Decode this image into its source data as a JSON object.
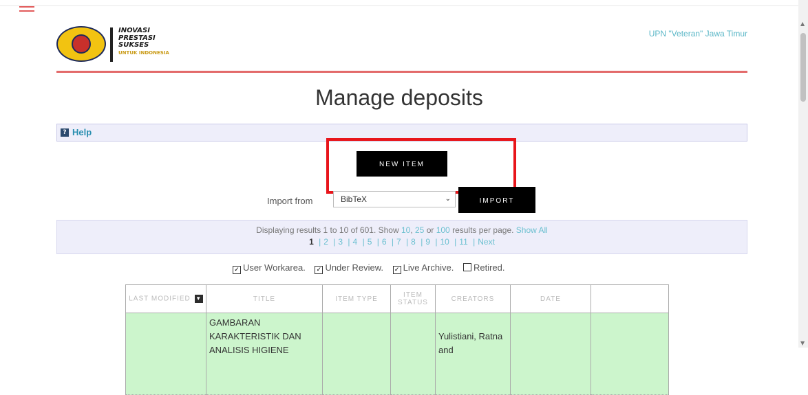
{
  "header": {
    "logo_lines": [
      "INOVASI",
      "PRESTASI",
      "SUKSES"
    ],
    "logo_sub": "UNTUK INDONESIA",
    "university_link": "UPN \"Veteran\" Jawa Timur"
  },
  "page_title": "Manage deposits",
  "help": {
    "label": "Help"
  },
  "new_item_label": "NEW ITEM",
  "import": {
    "label": "Import from",
    "selected": "BibTeX",
    "button_label": "IMPORT"
  },
  "results": {
    "text_prefix": "Displaying results 1 to 10 of 601. Show ",
    "opt10": "10",
    "opt25": "25",
    "or_text": " or ",
    "opt100": "100",
    "suffix": " results per page. ",
    "show_all": "Show All",
    "current_page": "1",
    "pages": [
      "2",
      "3",
      "4",
      "5",
      "6",
      "7",
      "8",
      "9",
      "10",
      "11"
    ],
    "next": "Next"
  },
  "filters": [
    {
      "label": "User Workarea",
      "checked": true
    },
    {
      "label": "Under Review",
      "checked": true
    },
    {
      "label": "Live Archive",
      "checked": true
    },
    {
      "label": "Retired",
      "checked": false
    }
  ],
  "table": {
    "headers": [
      "LAST MODIFIED",
      "TITLE",
      "ITEM TYPE",
      "ITEM STATUS",
      "CREATORS",
      "DATE",
      ""
    ],
    "rows": [
      {
        "last_modified": "",
        "title": "GAMBARAN KARAKTERISTIK DAN ANALISIS HIGIENE",
        "item_type": "",
        "item_status": "",
        "creators": "Yulistiani, Ratna and",
        "date": "",
        "extra": ""
      }
    ]
  }
}
